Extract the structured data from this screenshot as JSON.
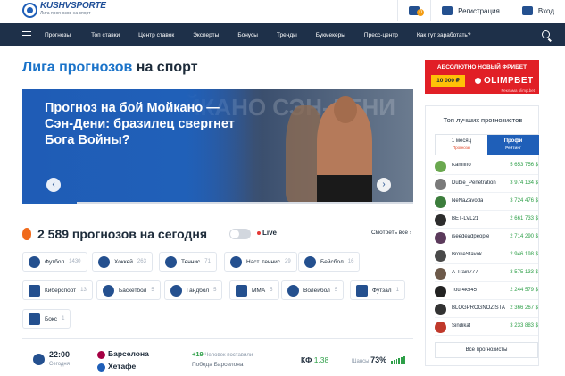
{
  "header": {
    "logo_name": "KUSHVSPORTE",
    "logo_tagline": "Лига прогнозов на спорт",
    "cart_badge": "0",
    "register_label": "Регистрация",
    "login_label": "Вход"
  },
  "nav": {
    "items": [
      "Прогнозы",
      "Топ ставки",
      "Центр ставок",
      "Эксперты",
      "Бонусы",
      "Тренды",
      "Букмекеры",
      "Пресс-центр",
      "Как тут заработать?"
    ]
  },
  "page": {
    "title_accent": "Лига прогнозов",
    "title_rest": " на спорт"
  },
  "hero": {
    "caption": "Прогноз на бой Мойкано — Сэн-Дени: бразилец свергнет Бога Войны?",
    "bg_text": "МОЙКАНО СЭН-ДЕНИ",
    "progress": 0.14
  },
  "predictions": {
    "count_text": "2 589 прогнозов на сегодня",
    "live_label": "Live",
    "see_all": "Смотреть все ›"
  },
  "sports": [
    {
      "label": "Футбол",
      "count": "1430",
      "icon": "soccer-ball-icon"
    },
    {
      "label": "Хоккей",
      "count": "263",
      "icon": "hockey-puck-icon"
    },
    {
      "label": "Теннис",
      "count": "71",
      "icon": "tennis-ball-icon"
    },
    {
      "label": "Наст. теннис",
      "count": "29",
      "icon": "table-tennis-icon"
    },
    {
      "label": "Бейсбол",
      "count": "16",
      "icon": "baseball-icon"
    },
    {
      "label": "Киберспорт",
      "count": "13",
      "icon": "gamepad-icon"
    },
    {
      "label": "Баскетбол",
      "count": "5",
      "icon": "basketball-icon"
    },
    {
      "label": "Гандбол",
      "count": "5",
      "icon": "handball-icon"
    },
    {
      "label": "MMA",
      "count": "5",
      "icon": "mma-glove-icon"
    },
    {
      "label": "Волейбол",
      "count": "5",
      "icon": "volleyball-icon"
    },
    {
      "label": "Футзал",
      "count": "1",
      "icon": "futsal-icon"
    },
    {
      "label": "Бокс",
      "count": "1",
      "icon": "boxing-glove-icon"
    }
  ],
  "match": {
    "time": "22:00",
    "day": "Сегодня",
    "team1": "Барселона",
    "team2": "Хетафе",
    "people_count": "+19",
    "people_text": " Человек поставили",
    "winner": "Победа Барселона",
    "kf_label": "КФ",
    "kf_value": "1.38",
    "chance_label": "Шансы ",
    "chance_value": "73%",
    "colors": {
      "team1": "#a50044",
      "team2": "#1f5fb8",
      "positive": "#2e9f48"
    }
  },
  "ad": {
    "title": "АБСОЛЮТНО НОВЫЙ ФРИБЕТ",
    "amount": "10 000 ₽",
    "brand": "OLIMPBET",
    "small": "Реклама olimp.bet"
  },
  "sidebar": {
    "title": "Топ лучших прогнозистов",
    "tab1": "1 месяц",
    "tab1_sub": "Прогнозы",
    "tab2": "Профи",
    "tab2_sub": "Рейтинг",
    "rows": [
      {
        "name": "KamilIfo",
        "score": "5 653 756 $"
      },
      {
        "name": "Dubie_Penetration",
        "score": "3 974 134 $"
      },
      {
        "name": "NeNaZavoda",
        "score": "3 724 476 $"
      },
      {
        "name": "BET-LVL21",
        "score": "2 661 733 $"
      },
      {
        "name": "iseedeadpeople",
        "score": "2 714 290 $"
      },
      {
        "name": "BrokeStavok",
        "score": "2 946 198 $"
      },
      {
        "name": "A-Train777",
        "score": "3 575 133 $"
      },
      {
        "name": "Tour4k545",
        "score": "2 244 579 $"
      },
      {
        "name": "BLOGPROGNOZISTA",
        "score": "2 366 267 $"
      },
      {
        "name": "Sindikat",
        "score": "3 233 883 $"
      }
    ],
    "button": "Все прогнозисты",
    "accent": "#1f5fb8"
  }
}
